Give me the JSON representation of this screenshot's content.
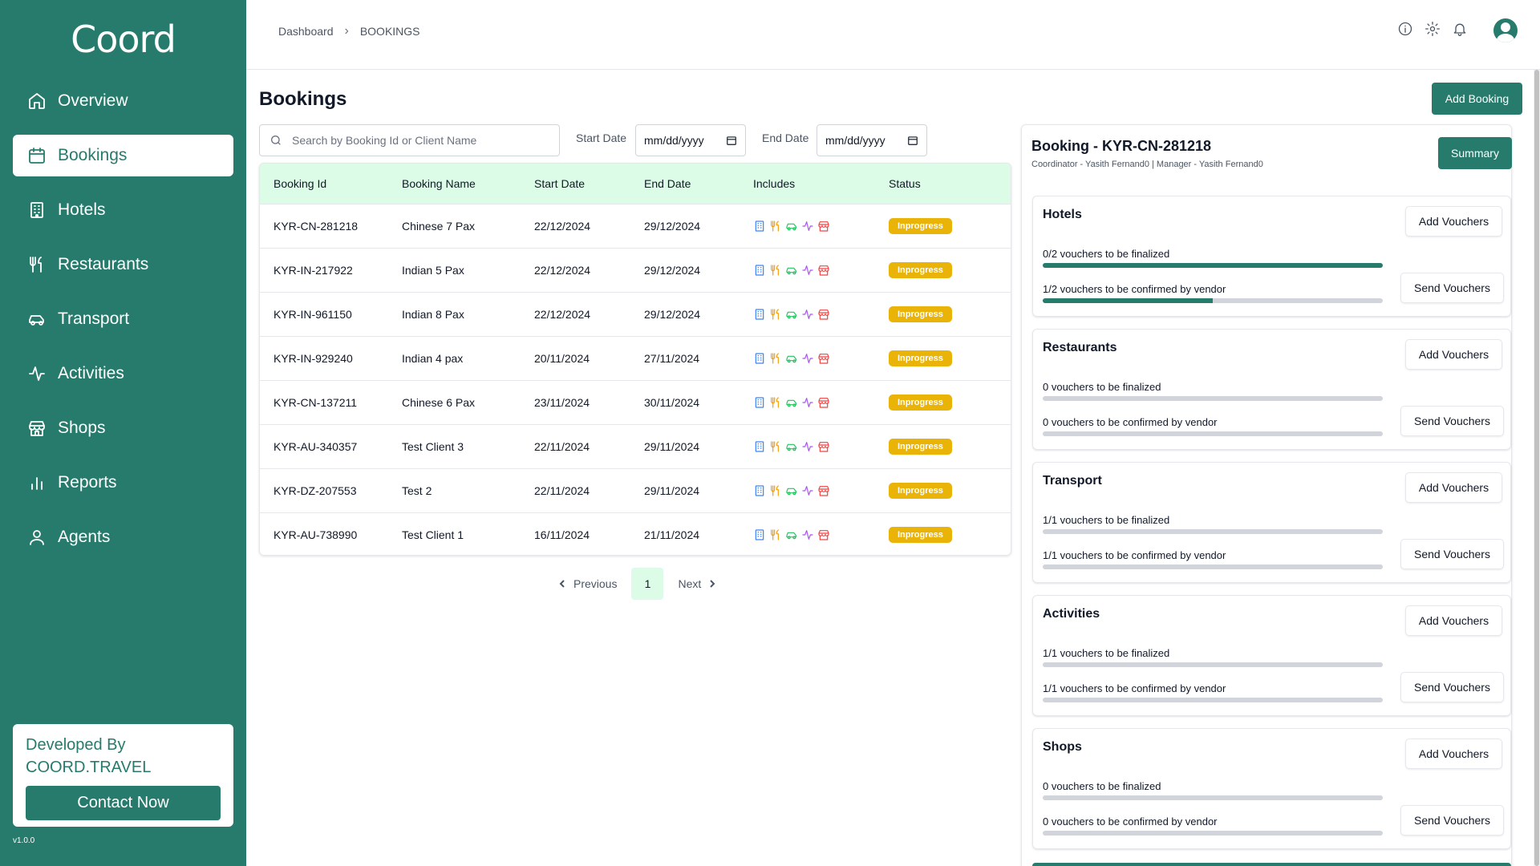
{
  "sidebar": {
    "logo": "Coord",
    "items": [
      {
        "label": "Overview",
        "icon": "home-icon",
        "active": false
      },
      {
        "label": "Bookings",
        "icon": "calendar-icon",
        "active": true
      },
      {
        "label": "Hotels",
        "icon": "building-icon",
        "active": false
      },
      {
        "label": "Restaurants",
        "icon": "utensils-icon",
        "active": false
      },
      {
        "label": "Transport",
        "icon": "car-icon",
        "active": false
      },
      {
        "label": "Activities",
        "icon": "activity-icon",
        "active": false
      },
      {
        "label": "Shops",
        "icon": "store-icon",
        "active": false
      },
      {
        "label": "Reports",
        "icon": "bar-chart-icon",
        "active": false
      },
      {
        "label": "Agents",
        "icon": "user-icon",
        "active": false
      }
    ],
    "developed_by": "Developed By",
    "company": "COORD.TRAVEL",
    "contact_label": "Contact Now",
    "version": "v1.0.0"
  },
  "header": {
    "breadcrumb": [
      "Dashboard",
      "BOOKINGS"
    ],
    "icons": [
      "info-icon",
      "gear-icon",
      "bell-icon",
      "avatar-icon"
    ]
  },
  "main": {
    "title": "Bookings",
    "add_booking_label": "Add Booking",
    "search_placeholder": "Search by Booking Id or Client Name",
    "start_date_label": "Start Date",
    "start_date_value": "mm/dd/yyyy",
    "end_date_label": "End Date",
    "end_date_value": "mm/dd/yyyy",
    "columns": [
      "Booking Id",
      "Booking Name",
      "Start Date",
      "End Date",
      "Includes",
      "Status"
    ],
    "rows": [
      {
        "id": "KYR-CN-281218",
        "name": "Chinese 7 Pax",
        "start": "22/12/2024",
        "end": "29/12/2024",
        "status": "Inprogress"
      },
      {
        "id": "KYR-IN-217922",
        "name": "Indian 5 Pax",
        "start": "22/12/2024",
        "end": "29/12/2024",
        "status": "Inprogress"
      },
      {
        "id": "KYR-IN-961150",
        "name": "Indian 8 Pax",
        "start": "22/12/2024",
        "end": "29/12/2024",
        "status": "Inprogress"
      },
      {
        "id": "KYR-IN-929240",
        "name": "Indian 4 pax",
        "start": "20/11/2024",
        "end": "27/11/2024",
        "status": "Inprogress"
      },
      {
        "id": "KYR-CN-137211",
        "name": "Chinese 6 Pax",
        "start": "23/11/2024",
        "end": "30/11/2024",
        "status": "Inprogress"
      },
      {
        "id": "KYR-AU-340357",
        "name": "Test Client 3",
        "start": "22/11/2024",
        "end": "29/11/2024",
        "status": "Inprogress"
      },
      {
        "id": "KYR-DZ-207553",
        "name": "Test 2",
        "start": "22/11/2024",
        "end": "29/11/2024",
        "status": "Inprogress"
      },
      {
        "id": "KYR-AU-738990",
        "name": "Test Client 1",
        "start": "16/11/2024",
        "end": "21/11/2024",
        "status": "Inprogress"
      }
    ],
    "include_icons": [
      {
        "icon": "hotel-icon",
        "color": "#3b82f6"
      },
      {
        "icon": "restaurant-icon",
        "color": "#f59e0b"
      },
      {
        "icon": "transport-icon",
        "color": "#22c55e"
      },
      {
        "icon": "activity-icon",
        "color": "#a855f7"
      },
      {
        "icon": "shop-icon",
        "color": "#ef4444"
      }
    ],
    "pager": {
      "previous": "Previous",
      "page": "1",
      "next": "Next"
    }
  },
  "panel": {
    "title": "Booking - KYR-CN-281218",
    "subtitle": "Coordinator - Yasith Fernand0 | Manager - Yasith Fernand0",
    "summary_label": "Summary",
    "add_label": "Add Vouchers",
    "send_label": "Send Vouchers",
    "sections": [
      {
        "title": "Hotels",
        "finalized_text": "0/2 vouchers to be finalized",
        "finalized_progress": 1.0,
        "confirmed_text": "1/2 vouchers to be confirmed by vendor",
        "confirmed_progress": 0.5
      },
      {
        "title": "Restaurants",
        "finalized_text": "0 vouchers to be finalized",
        "finalized_progress": 0,
        "confirmed_text": "0 vouchers to be confirmed by vendor",
        "confirmed_progress": 0
      },
      {
        "title": "Transport",
        "finalized_text": "1/1 vouchers to be finalized",
        "finalized_progress": 0,
        "confirmed_text": "1/1 vouchers to be confirmed by vendor",
        "confirmed_progress": 0
      },
      {
        "title": "Activities",
        "finalized_text": "1/1 vouchers to be finalized",
        "finalized_progress": 0,
        "confirmed_text": "1/1 vouchers to be confirmed by vendor",
        "confirmed_progress": 0
      },
      {
        "title": "Shops",
        "finalized_text": "0 vouchers to be finalized",
        "finalized_progress": 0,
        "confirmed_text": "0 vouchers to be confirmed by vendor",
        "confirmed_progress": 0
      }
    ]
  },
  "colors": {
    "brand": "#267b6c",
    "header_bg": "#dcfce7",
    "badge": "#eab308"
  }
}
